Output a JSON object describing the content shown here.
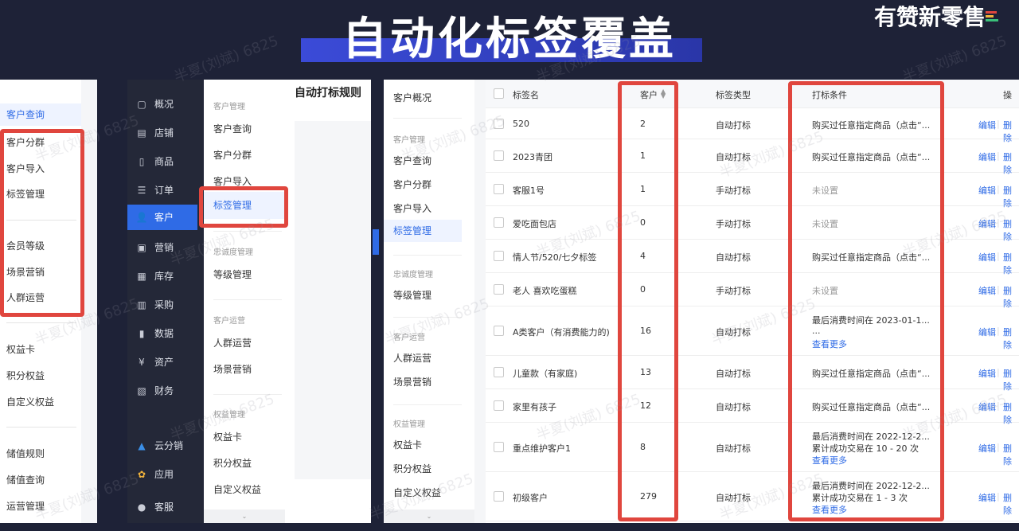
{
  "header": {
    "title": "自动化标签覆盖",
    "brand": "有赞新零售"
  },
  "watermark": "半夏(刘斌) 6825",
  "panel1": {
    "items": [
      "客户查询",
      "客户分群",
      "客户导入",
      "标签管理",
      "会员等级",
      "场景营销",
      "人群运营",
      "权益卡",
      "积分权益",
      "自定义权益",
      "储值规则",
      "储值查询",
      "运营管理"
    ]
  },
  "panel2": {
    "nav": [
      "概况",
      "店铺",
      "商品",
      "订单",
      "客户",
      "营销",
      "库存",
      "采购",
      "数据",
      "资产",
      "财务",
      "云分销",
      "应用",
      "客服"
    ],
    "nav_icons": [
      "▢",
      "▤",
      "▯",
      "☰",
      "👤",
      "▣",
      "▦",
      "▥",
      "▮",
      "¥",
      "▧",
      "▲",
      "✿",
      "●"
    ],
    "sub": {
      "group1": "客户管理",
      "items1": [
        "客户查询",
        "客户分群",
        "客户导入",
        "标签管理"
      ],
      "group2": "忠诚度管理",
      "items2": [
        "等级管理"
      ],
      "group3": "客户运营",
      "items3": [
        "人群运营",
        "场景营销"
      ],
      "group4": "权益管理",
      "items4": [
        "权益卡",
        "积分权益",
        "自定义权益"
      ]
    },
    "main_title": "自动打标规则"
  },
  "panel3": {
    "sub": {
      "top": "客户概况",
      "group1": "客户管理",
      "items1": [
        "客户查询",
        "客户分群",
        "客户导入",
        "标签管理"
      ],
      "group2": "忠诚度管理",
      "items2": [
        "等级管理"
      ],
      "group3": "客户运营",
      "items3": [
        "人群运营",
        "场景营销"
      ],
      "group4": "权益管理",
      "items4": [
        "权益卡",
        "积分权益",
        "自定义权益"
      ]
    },
    "table": {
      "headers": [
        "标签名",
        "客户",
        "标签类型",
        "打标条件",
        "操"
      ],
      "edit": "编辑",
      "delete": "删除",
      "rows": [
        {
          "name": "520",
          "count": "2",
          "type": "自动打标",
          "cond": [
            "购买过任意指定商品（点击“..."
          ],
          "more": ""
        },
        {
          "name": "2023青团",
          "count": "1",
          "type": "自动打标",
          "cond": [
            "购买过任意指定商品（点击“..."
          ],
          "more": ""
        },
        {
          "name": "客服1号",
          "count": "1",
          "type": "手动打标",
          "cond": [
            "未设置"
          ],
          "more": ""
        },
        {
          "name": "爱吃面包店",
          "count": "0",
          "type": "手动打标",
          "cond": [
            "未设置"
          ],
          "more": ""
        },
        {
          "name": "情人节/520/七夕标签",
          "count": "4",
          "type": "自动打标",
          "cond": [
            "购买过任意指定商品（点击“..."
          ],
          "more": ""
        },
        {
          "name": "老人 喜欢吃蛋糕",
          "count": "0",
          "type": "手动打标",
          "cond": [
            "未设置"
          ],
          "more": ""
        },
        {
          "name": "A类客户（有消费能力的)",
          "count": "16",
          "type": "自动打标",
          "cond": [
            "最后消费时间在 2023-01-1...",
            "..."
          ],
          "more": "查看更多"
        },
        {
          "name": "儿童款（有家庭)",
          "count": "13",
          "type": "自动打标",
          "cond": [
            "购买过任意指定商品（点击“..."
          ],
          "more": ""
        },
        {
          "name": "家里有孩子",
          "count": "12",
          "type": "自动打标",
          "cond": [
            "购买过任意指定商品（点击“..."
          ],
          "more": ""
        },
        {
          "name": "重点维护客户1",
          "count": "8",
          "type": "自动打标",
          "cond": [
            "最后消费时间在 2022-12-2...",
            "累计成功交易在 10 - 20 次"
          ],
          "more": "查看更多"
        },
        {
          "name": "初级客户",
          "count": "279",
          "type": "自动打标",
          "cond": [
            "最后消费时间在 2022-12-2...",
            "累计成功交易在 1 - 3 次"
          ],
          "more": "查看更多"
        }
      ]
    }
  },
  "colors": {
    "accent": "#2f6be6",
    "highlight": "#e0463e",
    "dark": "#1e2237"
  }
}
